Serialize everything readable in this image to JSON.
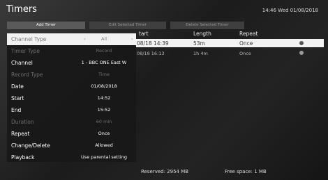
{
  "app": {
    "title": "Timers",
    "datetime": "14:46 Wed 01/08/2018"
  },
  "tabs": [
    "Add Timer",
    "Edit Selected Timer",
    "Delete Selected Timer"
  ],
  "timer_list": {
    "columns": [
      "tart",
      "Length",
      "Repeat"
    ],
    "rows": [
      {
        "start": "08/18 14:39",
        "length": "53m",
        "repeat": "Once"
      },
      {
        "start": "08/18 16:13",
        "length": "1h 4m",
        "repeat": "Once"
      }
    ]
  },
  "settings": [
    {
      "label": "Channel Type",
      "value": "All"
    },
    {
      "label": "Timer Type",
      "value": "Record"
    },
    {
      "label": "Channel",
      "value": "1 - BBC ONE East W"
    },
    {
      "label": "Record Type",
      "value": "Time"
    },
    {
      "label": "Date",
      "value": "01/08/2018"
    },
    {
      "label": "Start",
      "value": "14:52"
    },
    {
      "label": "End",
      "value": "15:52"
    },
    {
      "label": "Duration",
      "value": "60 min"
    },
    {
      "label": "Repeat",
      "value": "Once"
    },
    {
      "label": "Change/Delete",
      "value": "Allowed"
    },
    {
      "label": "Playback",
      "value": "Use parental setting"
    }
  ],
  "footer": {
    "reserved": "Reserved: 2954 MB",
    "free": "Free space: 1 MB"
  }
}
